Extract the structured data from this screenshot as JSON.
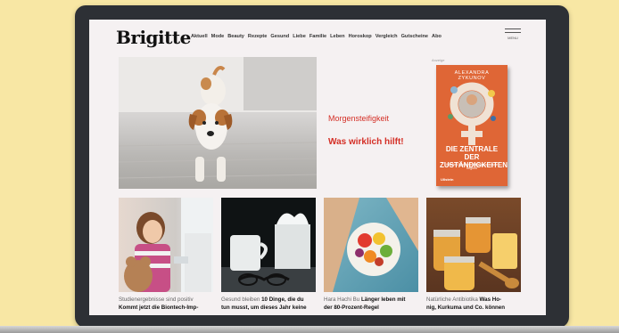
{
  "site": {
    "logo": "Brigitte",
    "nav": [
      "Aktuell",
      "Mode",
      "Beauty",
      "Rezepte",
      "Gesund",
      "Liebe",
      "Familie",
      "Leben",
      "Horoskop",
      "Vergleich",
      "Gutscheine",
      "Abo"
    ],
    "menu_label": "MENU"
  },
  "hero": {
    "line1": "Morgensteifigkeit",
    "line2": "Was wirklich hilft!",
    "image_icon": "dog-stretching-photo"
  },
  "ad": {
    "label": "Anzeige",
    "book_author": "ALEXANDRA ZYKUNOV",
    "book_title_line1": "DIE ZENTRALE DER",
    "book_title_line2": "ZUSTÄNDIGKEITEN",
    "book_subtitle": "Warum Gleichberechtigung zu Hause beginnt",
    "publisher": "Ullstein"
  },
  "cards": [
    {
      "pre": "Studienergebnisse sind positiv",
      "headline": "Kommt jetzt die Biontech-Imp-",
      "image_icon": "child-vaccination-photo"
    },
    {
      "pre": "Gesund bleiben",
      "headline": "10 Dinge, die du",
      "line2": "tun musst, um dieses Jahr keine",
      "image_icon": "tea-tissues-photo"
    },
    {
      "pre": "Hara Hachi Bu",
      "headline": "Länger leben mit",
      "line2": "der 80-Prozent-Regel",
      "image_icon": "fruit-plate-photo"
    },
    {
      "pre": "Natürliche Antibiotika",
      "headline": "Was Ho-",
      "line2": "nig, Kurkuma und Co. können",
      "image_icon": "honey-jars-photo"
    }
  ],
  "colors": {
    "accent": "#d42f26",
    "background": "#f8e7a4",
    "laptop_frame": "#2d3035",
    "book": "#df6636"
  }
}
